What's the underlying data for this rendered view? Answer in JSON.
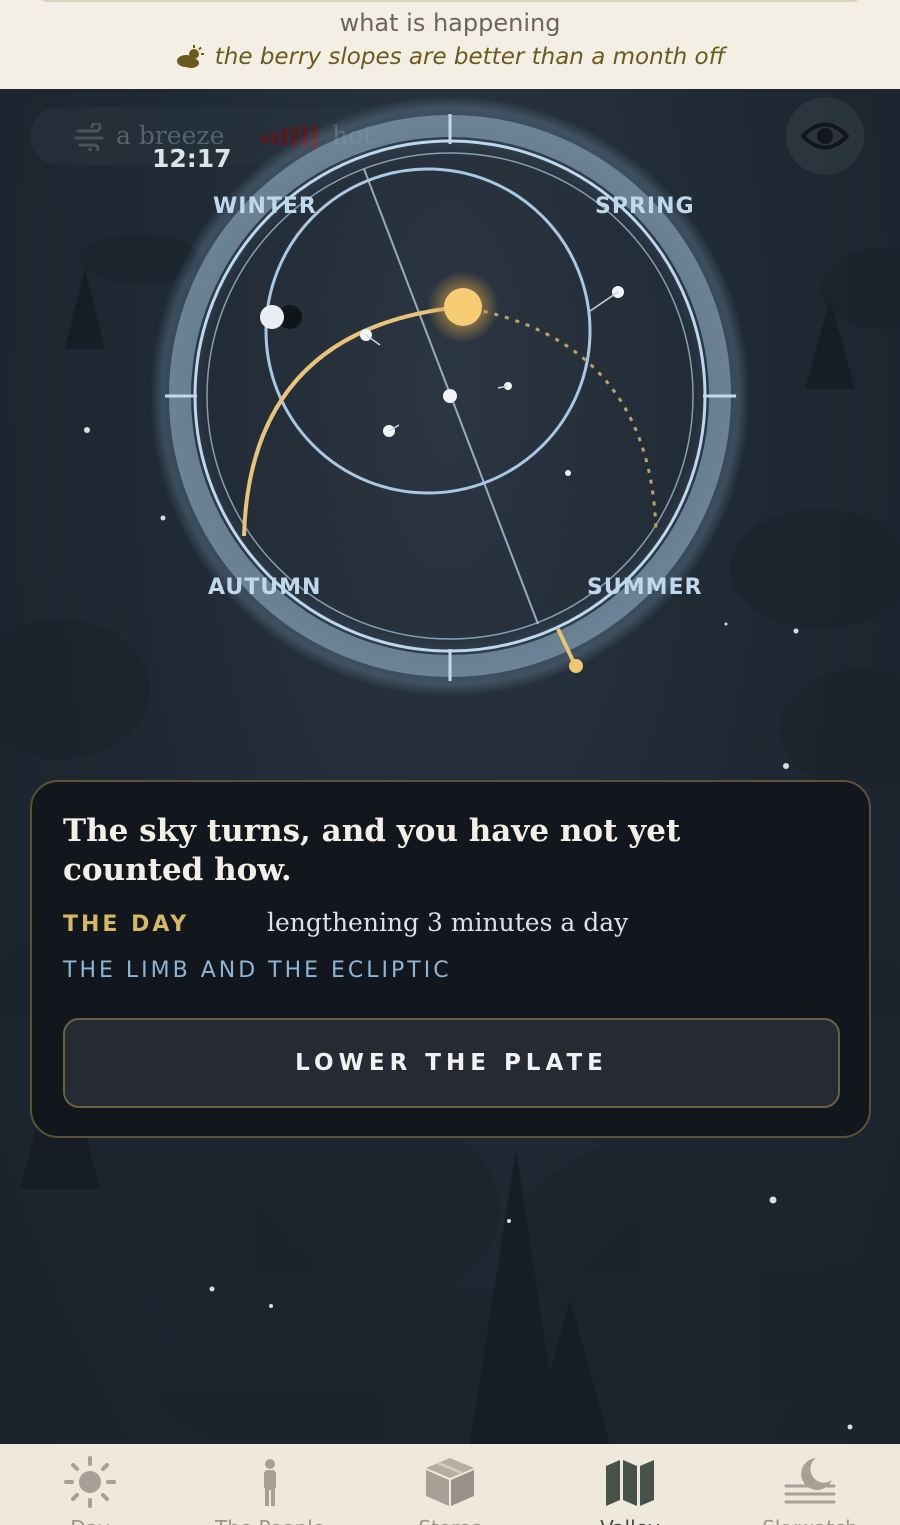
{
  "banner": {
    "heading": "what is happening",
    "note": "the berry slopes are better than a month off",
    "note_icon": "partly-cloudy-icon"
  },
  "status": {
    "wind": "a breeze",
    "heat": "hot"
  },
  "clock": "12:17",
  "seasons": {
    "winter": "WINTER",
    "spring": "SPRING",
    "autumn": "AUTUMN",
    "summer": "SUMMER"
  },
  "card": {
    "title": "The sky turns, and you have not yet counted how.",
    "day_label": "THE DAY",
    "day_value": "lengthening 3 minutes a day",
    "section_label": "THE LIMB AND THE ECLIPTIC",
    "action_label": "LOWER THE PLATE"
  },
  "nav": {
    "tabs": [
      {
        "label": "Day",
        "icon": "sun-icon"
      },
      {
        "label": "The People",
        "icon": "person-icon"
      },
      {
        "label": "Stores",
        "icon": "box-icon"
      },
      {
        "label": "Valley",
        "icon": "map-icon",
        "active": true
      },
      {
        "label": "Skywatch",
        "icon": "moon-horizon-icon"
      }
    ]
  },
  "colors": {
    "accent_gold": "#d4b866",
    "sky_blue": "#8fb4d4",
    "banner_bg": "#f3efe4",
    "card_bg": "#12171e"
  }
}
